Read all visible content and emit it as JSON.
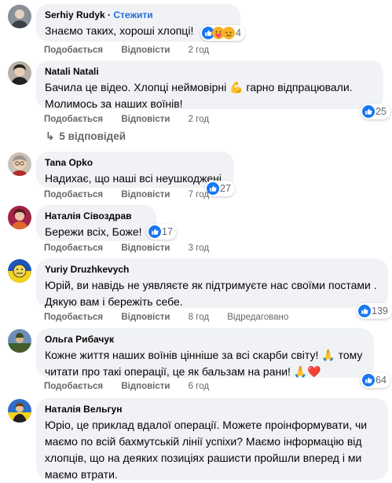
{
  "labels": {
    "like": "Подобається",
    "reply": "Відповісти"
  },
  "comments": [
    {
      "author": "Serhiy Rudyk",
      "follow": "Стежити",
      "text": "Знаємо таких, хороші хлопці!",
      "time": "2 год",
      "reactions": 4,
      "reaction_icons": [
        "like-icon",
        "care-icon",
        "sad-icon"
      ]
    },
    {
      "author": "Natali Natali",
      "text_1": "Бачила це відео. Хлопці неймовірні",
      "text_1b": "гарно відпрацювали.",
      "text_2": "Молимось за наших воїнів!",
      "emoji": "💪",
      "time": "2 год",
      "reactions": 25,
      "replies": "5 відповідей"
    },
    {
      "author": "Tana Opko",
      "text": "Надихає, що наші всі неушкоджені.",
      "time": "7 год",
      "reactions": 27
    },
    {
      "author": "Наталія Сівоздрав",
      "text": "Бережи всіх, Боже!",
      "time": "3 год",
      "reactions": 17
    },
    {
      "author": "Yuriy Druzhkevych",
      "text_1": "Юрій, ви навідь не уявляєте як підтримуєте нас своїми постами .",
      "text_2": "Дякую вам і бережіть себе.",
      "time": "8 год",
      "edited": "Відредаговано",
      "reactions": 139
    },
    {
      "author": "Ольга Рибачук",
      "text_1": "Кожне життя наших воїнів цінніше за всі скарби світу!",
      "text_1b": "тому",
      "text_2": "читати про такі операції, це як бальзам на рани!",
      "emoji_pray": "🙏",
      "emoji_heart": "❤️",
      "time": "6 год",
      "reactions": 64
    },
    {
      "author": "Наталія Вельгун",
      "text_1": "Юріо, це приклад вдалої операції. Можете проінформувати, чи",
      "text_2": "маємо по всій бахмутській лінії успіхи? Маємо інформацію від",
      "text_3": "хлопців, що на деяких позиціях рашисти пройшли вперед і ми",
      "text_4": "маємо втрати."
    }
  ],
  "colors": {
    "bubble": "#f0f2f5",
    "link": "#216fdb",
    "meta": "#65676b",
    "like_blue": "#1877f2"
  }
}
